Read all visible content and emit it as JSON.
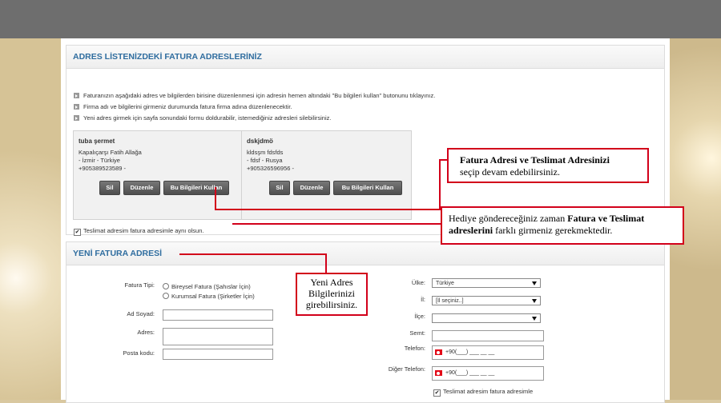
{
  "panel1": {
    "title": "ADRES LİSTENİZDEKİ FATURA ADRESLERİNİZ",
    "notes": [
      "Faturanızın aşağıdaki adres ve bilgilerden birisine düzenlenmesi için adresin hemen altındaki \"Bu bilgileri kullan\" butonunu tıklayınız.",
      "Firma adı ve bilgilerini girmeniz durumunda fatura firma adına düzenlenecektir.",
      "Yeni adres girmek için sayfa sonundaki formu doldurabilir, istemediğiniz adresleri silebilirsiniz."
    ],
    "cards": [
      {
        "name": "tuba şermet",
        "lines": [
          "Kapalıçarşı Fatih Allağa",
          "- İzmir - Türkiye",
          "+905389523589 -"
        ]
      },
      {
        "name": "dskjdmö",
        "lines": [
          "kldsşm fdsfds",
          "- fdsf - Rusya",
          "+905326596956 -"
        ]
      }
    ],
    "buttons": {
      "delete": "Sil",
      "edit": "Düzenle",
      "use": "Bu Bilgileri Kullan"
    },
    "same_address_label": "Teslimat adresim fatura adresimle aynı olsun."
  },
  "panel2": {
    "title": "YENİ FATURA ADRESİ",
    "invoice_type_label": "Fatura Tipi:",
    "invoice_type_options": [
      "Bireysel Fatura (Şahıslar İçin)",
      "Kurumsal Fatura (Şirketler İçin)"
    ],
    "name_label": "Ad Soyad:",
    "address_label": "Adres:",
    "postal_label": "Posta kodu:",
    "country_label": "Ülke:",
    "country_value": "Türkiye",
    "city_label": "İl:",
    "city_value": "[İl seçiniz..]",
    "district_label": "İlçe:",
    "semt_label": "Semt:",
    "phone_label": "Telefon:",
    "phone_value": "+90(___) ___ __ __",
    "other_phone_label": "Diğer Telefon:",
    "other_phone_value": "+90(___) ___ __ __",
    "same_address_label": "Teslimat adresim fatura adresimle"
  },
  "callouts": {
    "c1_bold": "Fatura Adresi ve  Teslimat Adresinizi",
    "c1_rest": "seçip devam edebilirsiniz.",
    "c2_pre": "Hediye göndereceğiniz zaman ",
    "c2_bold": "Fatura ve Teslimat adreslerini",
    "c2_post": " farklı girmeniz gerekmektedir.",
    "c3_l1": "Yeni Adres",
    "c3_l2": "Bilgilerinizi",
    "c3_l3": "girebilirsiniz."
  },
  "colors": {
    "accent": "#2f6d9f",
    "callout_red": "#d2001a",
    "topbar": "#6e6e6e"
  }
}
